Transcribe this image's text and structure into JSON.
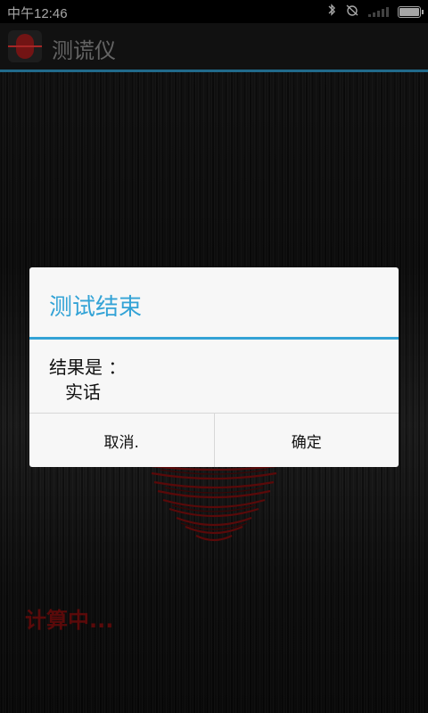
{
  "status_bar": {
    "time": "中午12:46",
    "icons": [
      "bluetooth-icon",
      "alarm-off-icon",
      "signal-icon",
      "battery-icon"
    ]
  },
  "action_bar": {
    "title": "测谎仪",
    "icon": "fingerprint-app-icon"
  },
  "background": {
    "status_text": "计算中..."
  },
  "dialog": {
    "title": "测试结束",
    "body_line1": "结果是 ：",
    "body_line2": "实话",
    "cancel_label": "取消.",
    "ok_label": "确定"
  },
  "colors": {
    "accent": "#33a3d6",
    "status_red": "#8a1010"
  }
}
